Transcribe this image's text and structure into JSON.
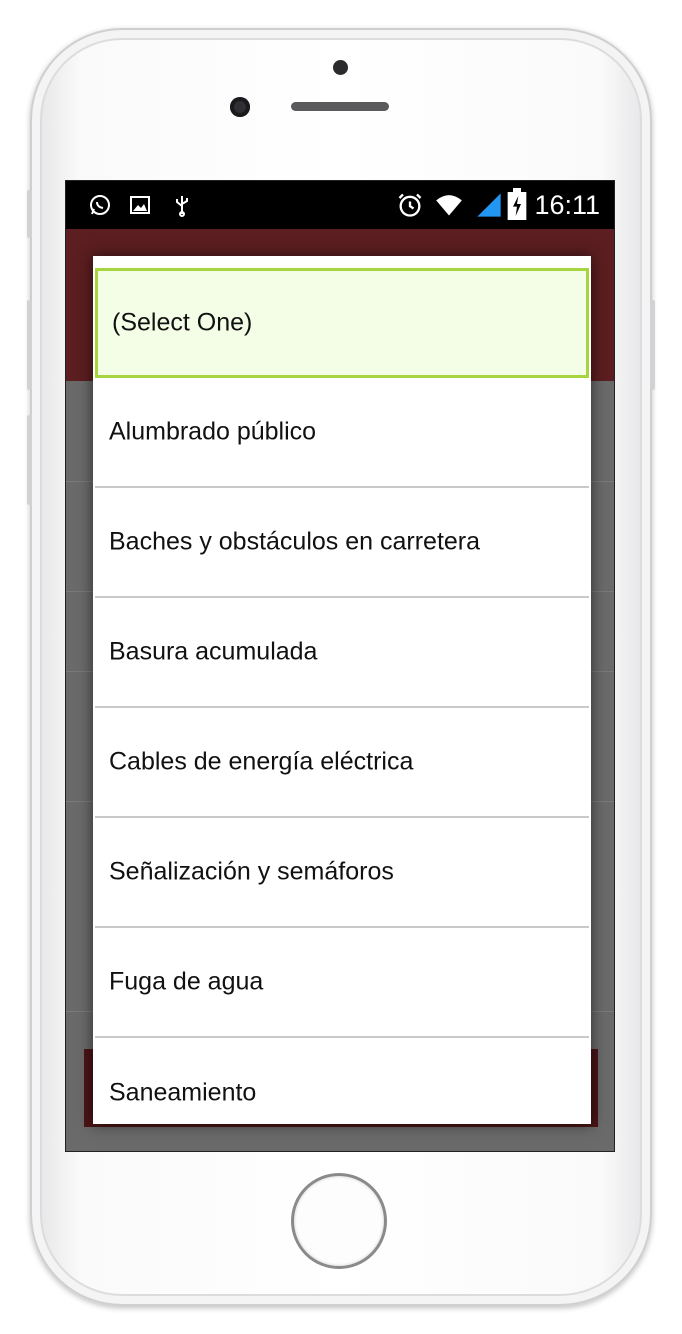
{
  "status_bar": {
    "time": "16:11",
    "left_icons": [
      "whatsapp-icon",
      "image-icon",
      "usb-icon"
    ],
    "right_icons": [
      "alarm-icon",
      "wifi-icon",
      "signal-icon",
      "battery-charging-icon"
    ]
  },
  "dialog": {
    "options": [
      {
        "label": "(Select One)",
        "selected": true
      },
      {
        "label": "Alumbrado público",
        "selected": false
      },
      {
        "label": "Baches y obstáculos en carretera",
        "selected": false
      },
      {
        "label": "Basura acumulada",
        "selected": false
      },
      {
        "label": "Cables de energía eléctrica",
        "selected": false
      },
      {
        "label": "Señalización y semáforos",
        "selected": false
      },
      {
        "label": "Fuga de agua",
        "selected": false
      },
      {
        "label": "Saneamiento",
        "selected": false
      }
    ]
  },
  "colors": {
    "header": "#5c1e20",
    "selected_bg": "#f4fde6",
    "selected_border": "#a6d53f",
    "signal": "#2196f3"
  }
}
